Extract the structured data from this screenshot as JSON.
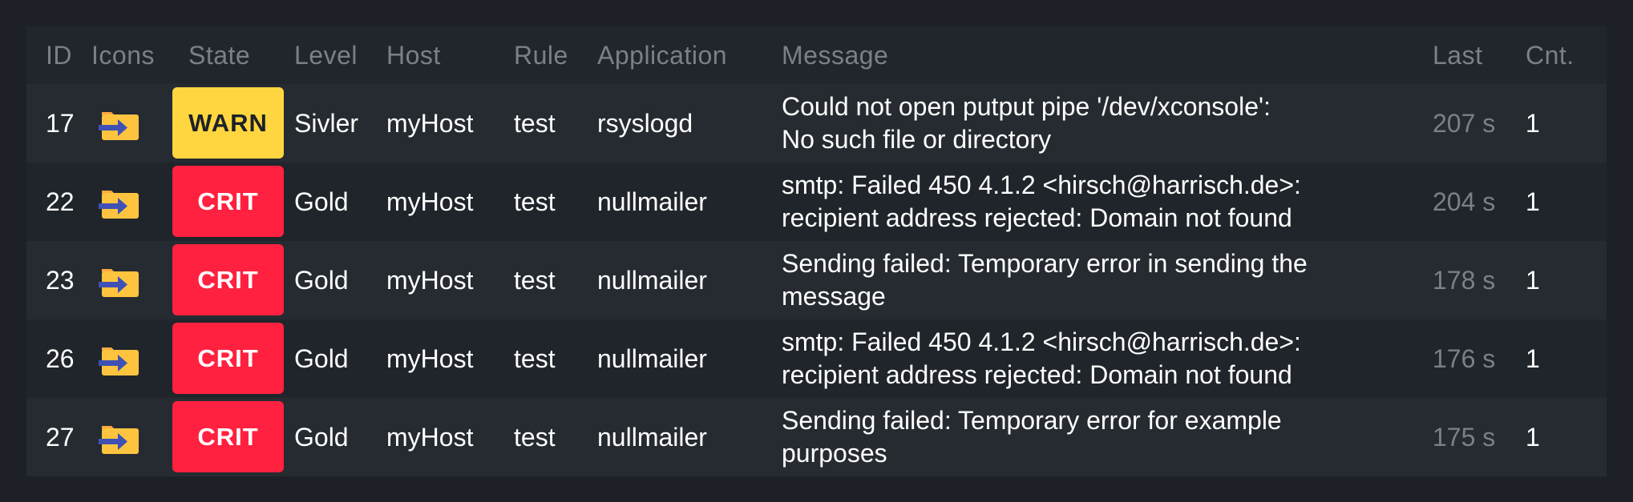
{
  "colors": {
    "warn": "#ffd63f",
    "crit": "#ff213f",
    "folder": "#ffc43f",
    "arrow": "#3f51b5"
  },
  "columns": [
    "ID",
    "Icons",
    "State",
    "Level",
    "Host",
    "Rule",
    "Application",
    "Message",
    "Last",
    "Cnt."
  ],
  "rows": [
    {
      "id": "17",
      "icon": "folder-arrow-icon",
      "state": "WARN",
      "level": "Sivler",
      "host": "myHost",
      "rule": "test",
      "application": "rsyslogd",
      "message": [
        "Could not open putput pipe '/dev/xconsole':",
        "No such file or directory"
      ],
      "last": "207 s",
      "count": "1"
    },
    {
      "id": "22",
      "icon": "folder-arrow-icon",
      "state": "CRIT",
      "level": "Gold",
      "host": "myHost",
      "rule": "test",
      "application": "nullmailer",
      "message": [
        "smtp: Failed 450 4.1.2 <hirsch@harrisch.de>:",
        "recipient address rejected: Domain not found"
      ],
      "last": "204 s",
      "count": "1"
    },
    {
      "id": "23",
      "icon": "folder-arrow-icon",
      "state": "CRIT",
      "level": "Gold",
      "host": "myHost",
      "rule": "test",
      "application": "nullmailer",
      "message": [
        "Sending failed: Temporary error in sending the",
        "message"
      ],
      "last": "178 s",
      "count": "1"
    },
    {
      "id": "26",
      "icon": "folder-arrow-icon",
      "state": "CRIT",
      "level": "Gold",
      "host": "myHost",
      "rule": "test",
      "application": "nullmailer",
      "message": [
        "smtp: Failed 450 4.1.2 <hirsch@harrisch.de>:",
        "recipient address rejected: Domain not found"
      ],
      "last": "176 s",
      "count": "1"
    },
    {
      "id": "27",
      "icon": "folder-arrow-icon",
      "state": "CRIT",
      "level": "Gold",
      "host": "myHost",
      "rule": "test",
      "application": "nullmailer",
      "message": [
        "Sending failed: Temporary error for example",
        "purposes"
      ],
      "last": "175 s",
      "count": "1"
    }
  ]
}
